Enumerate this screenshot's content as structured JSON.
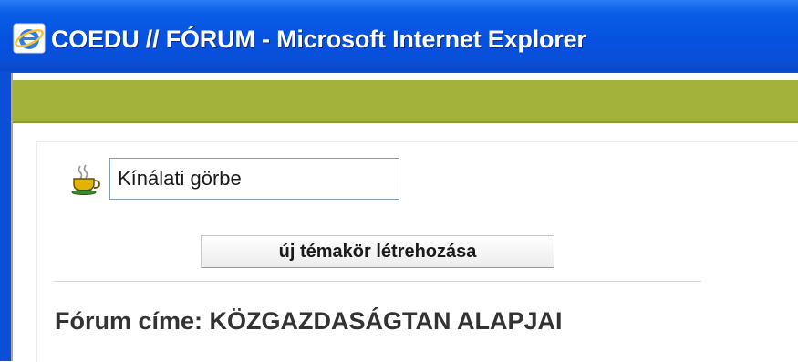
{
  "window": {
    "title": "COEDU // FÓRUM - Microsoft Internet Explorer",
    "icon": "internet-explorer-icon"
  },
  "form": {
    "topic_icon": "coffee-cup-icon",
    "topic_input_value": "Kínálati görbe",
    "create_button_label": "új témakör létrehozása"
  },
  "forum": {
    "title": "Fórum címe: KÖZGAZDASÁGTAN ALAPJAI"
  },
  "colors": {
    "titlebar": "#0a4fd8",
    "green_band": "#a3b23a",
    "input_border": "#7f9db9"
  }
}
